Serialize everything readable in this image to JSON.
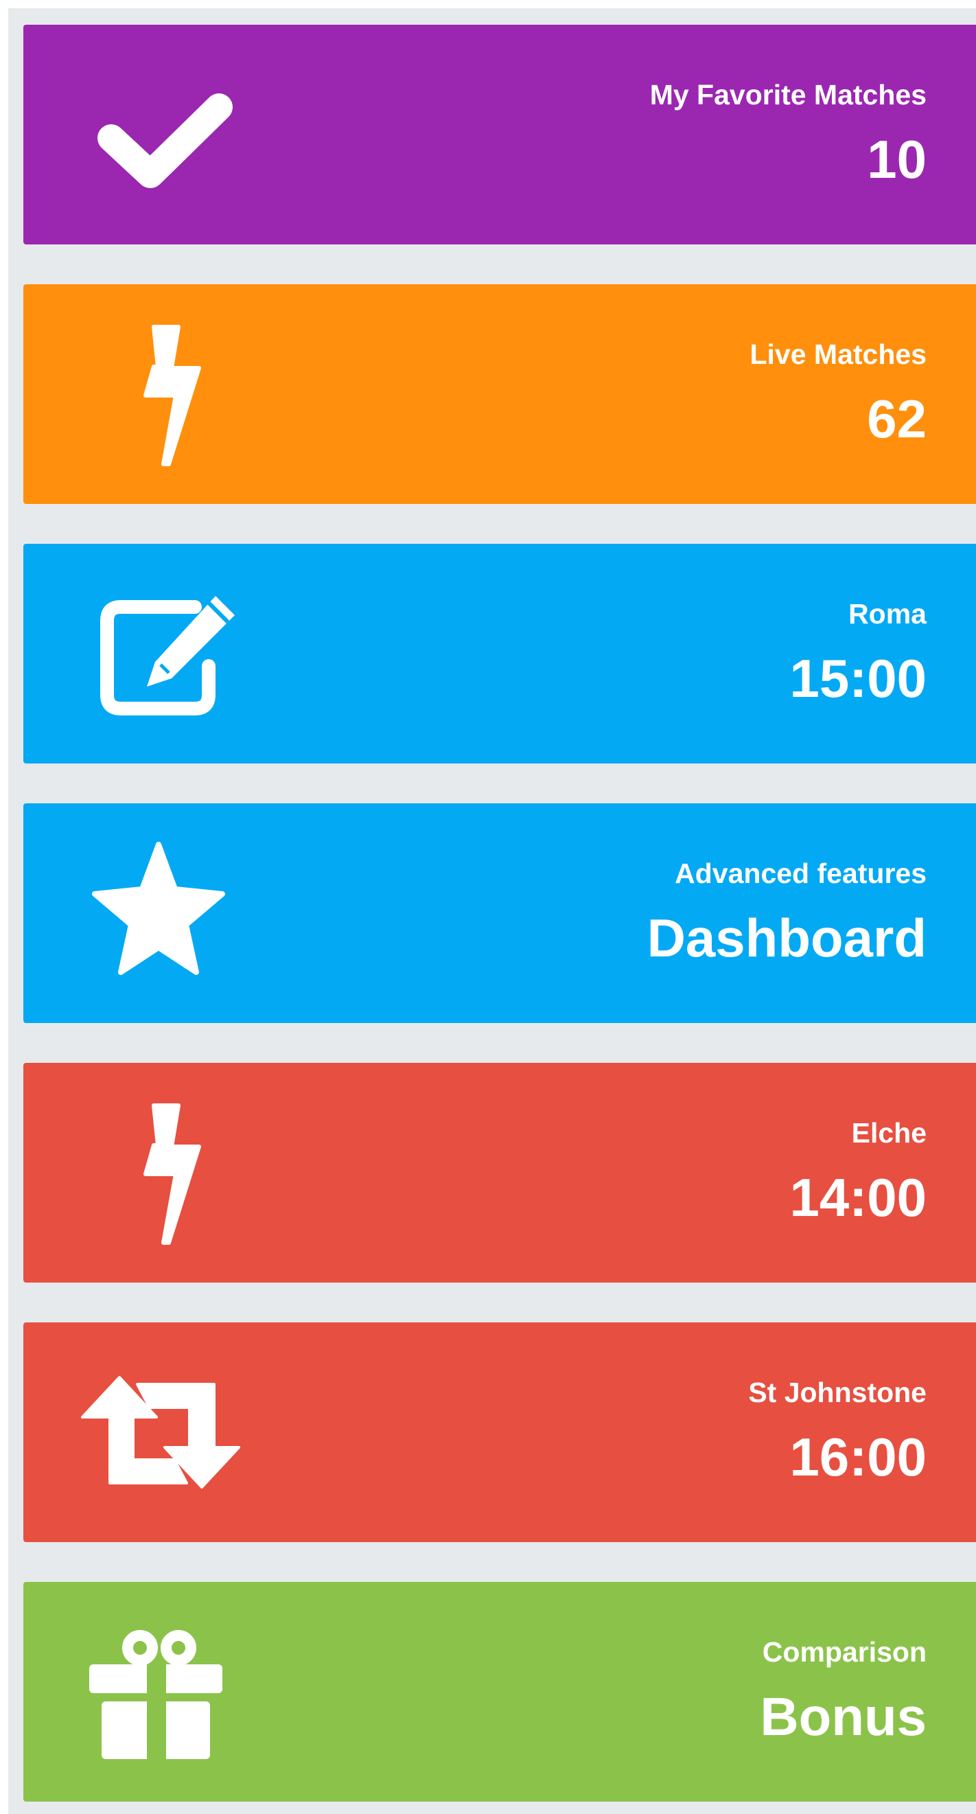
{
  "colors": {
    "background": "#e7eaec",
    "purple": "#9b27b1",
    "orange": "#ff8f0c",
    "blue": "#04a9f4",
    "red": "#e74f40",
    "green": "#8bc34a",
    "text": "#ffffff"
  },
  "tiles": [
    {
      "icon": "checkmark-icon",
      "color": "#9b27b1",
      "label": "My Favorite Matches",
      "value": "10"
    },
    {
      "icon": "lightning-icon",
      "color": "#ff8f0c",
      "label": "Live Matches",
      "value": "62"
    },
    {
      "icon": "edit-icon",
      "color": "#04a9f4",
      "label": "Roma",
      "value": "15:00"
    },
    {
      "icon": "star-icon",
      "color": "#04a9f4",
      "label": "Advanced features",
      "value": "Dashboard"
    },
    {
      "icon": "lightning-icon",
      "color": "#e74f40",
      "label": "Elche",
      "value": "14:00"
    },
    {
      "icon": "retweet-icon",
      "color": "#e74f40",
      "label": "St Johnstone",
      "value": "16:00"
    },
    {
      "icon": "gift-icon",
      "color": "#8bc34a",
      "label": "Comparison",
      "value": "Bonus"
    }
  ]
}
